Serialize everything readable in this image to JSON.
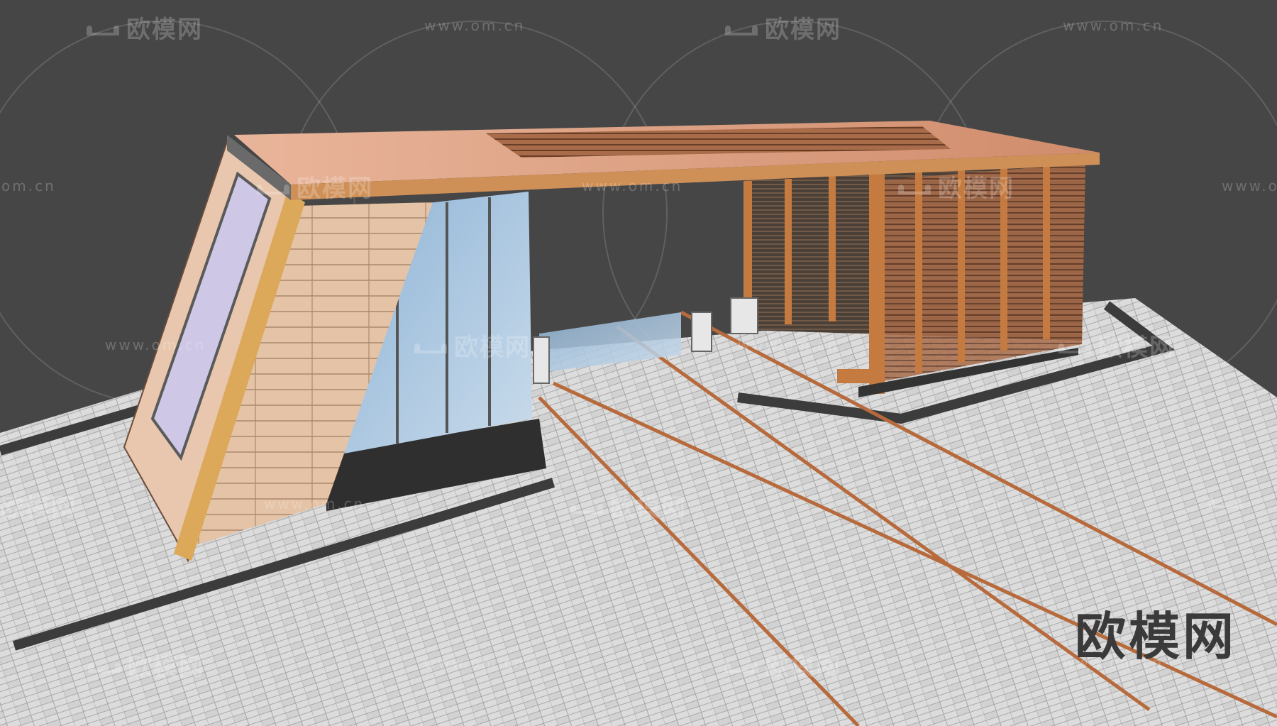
{
  "watermark": {
    "logo_text": "欧模网",
    "url_text": "www.om.cn",
    "url_partial": "om.cn"
  },
  "brand_mark": "欧模网",
  "colors": {
    "background": "#464646",
    "floor": "#d9d9d9",
    "copper": "#d79a7a",
    "wood": "#c8884a",
    "glass": "#9fc0dc"
  }
}
